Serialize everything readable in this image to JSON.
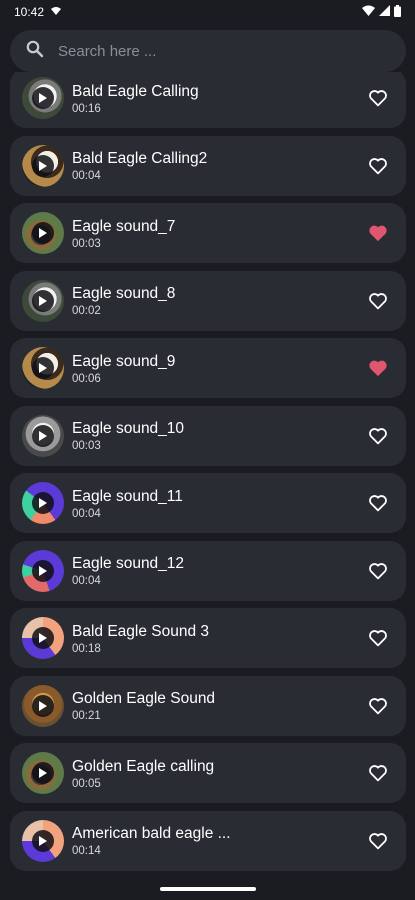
{
  "status": {
    "time": "10:42"
  },
  "search": {
    "placeholder": "Search here ..."
  },
  "items": [
    {
      "title": "Bald Eagle Calling",
      "duration": "00:16",
      "favorite": false,
      "thumb": "eagle-white"
    },
    {
      "title": "Bald Eagle Calling2",
      "duration": "00:04",
      "favorite": false,
      "thumb": "eagle-brown"
    },
    {
      "title": "Eagle sound_7",
      "duration": "00:03",
      "favorite": true,
      "thumb": "bird-green"
    },
    {
      "title": "Eagle sound_8",
      "duration": "00:02",
      "favorite": false,
      "thumb": "eagle-white"
    },
    {
      "title": "Eagle sound_9",
      "duration": "00:06",
      "favorite": true,
      "thumb": "eagle-brown"
    },
    {
      "title": "Eagle sound_10",
      "duration": "00:03",
      "favorite": false,
      "thumb": "eagle-grey"
    },
    {
      "title": "Eagle sound_11",
      "duration": "00:04",
      "favorite": false,
      "thumb": "logo-purple-green"
    },
    {
      "title": "Eagle sound_12",
      "duration": "00:04",
      "favorite": false,
      "thumb": "logo-purple-coral"
    },
    {
      "title": "Bald Eagle Sound 3",
      "duration": "00:18",
      "favorite": false,
      "thumb": "logo-peach-purple"
    },
    {
      "title": "Golden Eagle Sound",
      "duration": "00:21",
      "favorite": false,
      "thumb": "eagle-golden"
    },
    {
      "title": "Golden Eagle calling",
      "duration": "00:05",
      "favorite": false,
      "thumb": "bird-green"
    },
    {
      "title": "American bald eagle ...",
      "duration": "00:14",
      "favorite": false,
      "thumb": "logo-peach-purple"
    }
  ],
  "colors": {
    "favorite": "#e0566f",
    "card": "#2a2c34",
    "background": "#1b1c21"
  }
}
